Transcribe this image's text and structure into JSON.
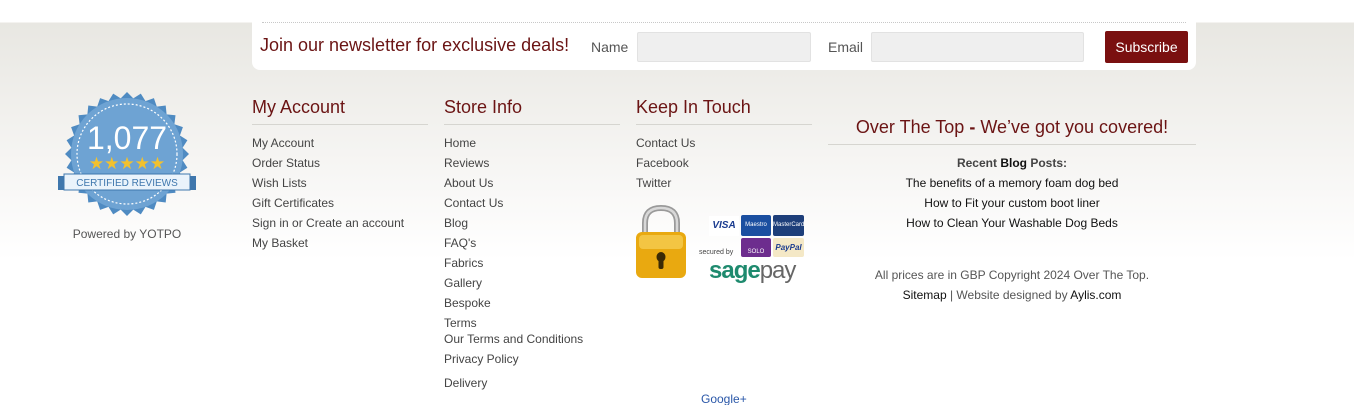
{
  "newsletter": {
    "title": "Join our newsletter for exclusive deals!",
    "name_label": "Name",
    "name_value": "",
    "email_label": "Email",
    "email_value": "",
    "subscribe_label": "Subscribe"
  },
  "badge": {
    "count": "1,077",
    "caption": "CERTIFIED REVIEWS",
    "stars": 5,
    "powered_by": "Powered by YOTPO"
  },
  "columns": {
    "account": {
      "title": "My Account",
      "items": [
        "My Account",
        "Order Status",
        "Wish Lists",
        "Gift Certificates",
        "Sign in or Create an account",
        "My Basket"
      ]
    },
    "store": {
      "title": "Store Info",
      "items": [
        "Home",
        "Reviews",
        "About Us",
        "Contact Us",
        "Blog",
        "FAQ's",
        "Fabrics",
        "Gallery",
        "Bespoke",
        "Terms",
        "Our Terms and Conditions",
        "Privacy Policy",
        "Delivery"
      ]
    },
    "touch": {
      "title": "Keep In Touch",
      "items": [
        "Contact Us",
        "Facebook",
        "Twitter"
      ]
    }
  },
  "payment": {
    "secured_by": "secured by",
    "brand": "sage",
    "brand_suffix": "pay",
    "cards": [
      "VISA",
      "Maestro",
      "MasterCard",
      "SOLO",
      "PayPal"
    ]
  },
  "right": {
    "title_a": "Over The Top",
    "title_dash": "-",
    "title_b": "We’ve got you covered!",
    "recent_prefix": "Recent",
    "recent_blog": "Blog",
    "recent_suffix": "Posts:",
    "posts": [
      "The benefits of a memory foam dog bed",
      "How to Fit your custom boot liner",
      "How to Clean Your Washable Dog Beds"
    ],
    "copyright": "All prices are in GBP Copyright 2024 Over The Top.",
    "sitemap": "Sitemap",
    "designed_by": "| Website designed by",
    "designer": "Aylis.com"
  },
  "google_plus": "Google+",
  "colors": {
    "accent": "#6b1414",
    "button": "#7a1010",
    "badge_blue": "#5b93c7",
    "star": "#f2c12e"
  }
}
